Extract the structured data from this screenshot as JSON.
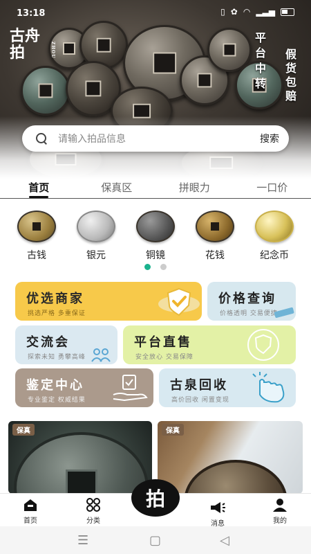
{
  "status": {
    "time": "13:18"
  },
  "hero": {
    "logo": "古舟拍",
    "logo_sub": "ZHOU",
    "tag1": "平台中转",
    "tag2": "假货包赔"
  },
  "search": {
    "placeholder": "请输入拍品信息",
    "button": "搜索"
  },
  "tabs": [
    "首页",
    "保真区",
    "拼眼力",
    "一口价"
  ],
  "categories": [
    "古钱",
    "银元",
    "铜镜",
    "花钱",
    "纪念币"
  ],
  "cards": {
    "featured": {
      "title": "优选商家",
      "sub": "挑选严格  多重保证"
    },
    "price": {
      "title": "价格查询",
      "sub": "价格透明  交易便捷"
    },
    "exchange": {
      "title": "交流会",
      "sub": "探索未知  勇攀高峰"
    },
    "direct": {
      "title": "平台直售",
      "sub": "安全放心  交易保障"
    },
    "appraisal": {
      "title": "鉴定中心",
      "sub": "专业鉴定  权威结果"
    },
    "recycle": {
      "title": "古泉回收",
      "sub": "高价回收  闲置变现"
    }
  },
  "products": [
    {
      "badge": "保真"
    },
    {
      "badge": "保真"
    }
  ],
  "nav": {
    "home": "首页",
    "category": "分类",
    "center": "拍",
    "message": "消息",
    "mine": "我的"
  },
  "colors": {
    "accent": "#1ab28e",
    "yellow": "#f7c94a"
  }
}
